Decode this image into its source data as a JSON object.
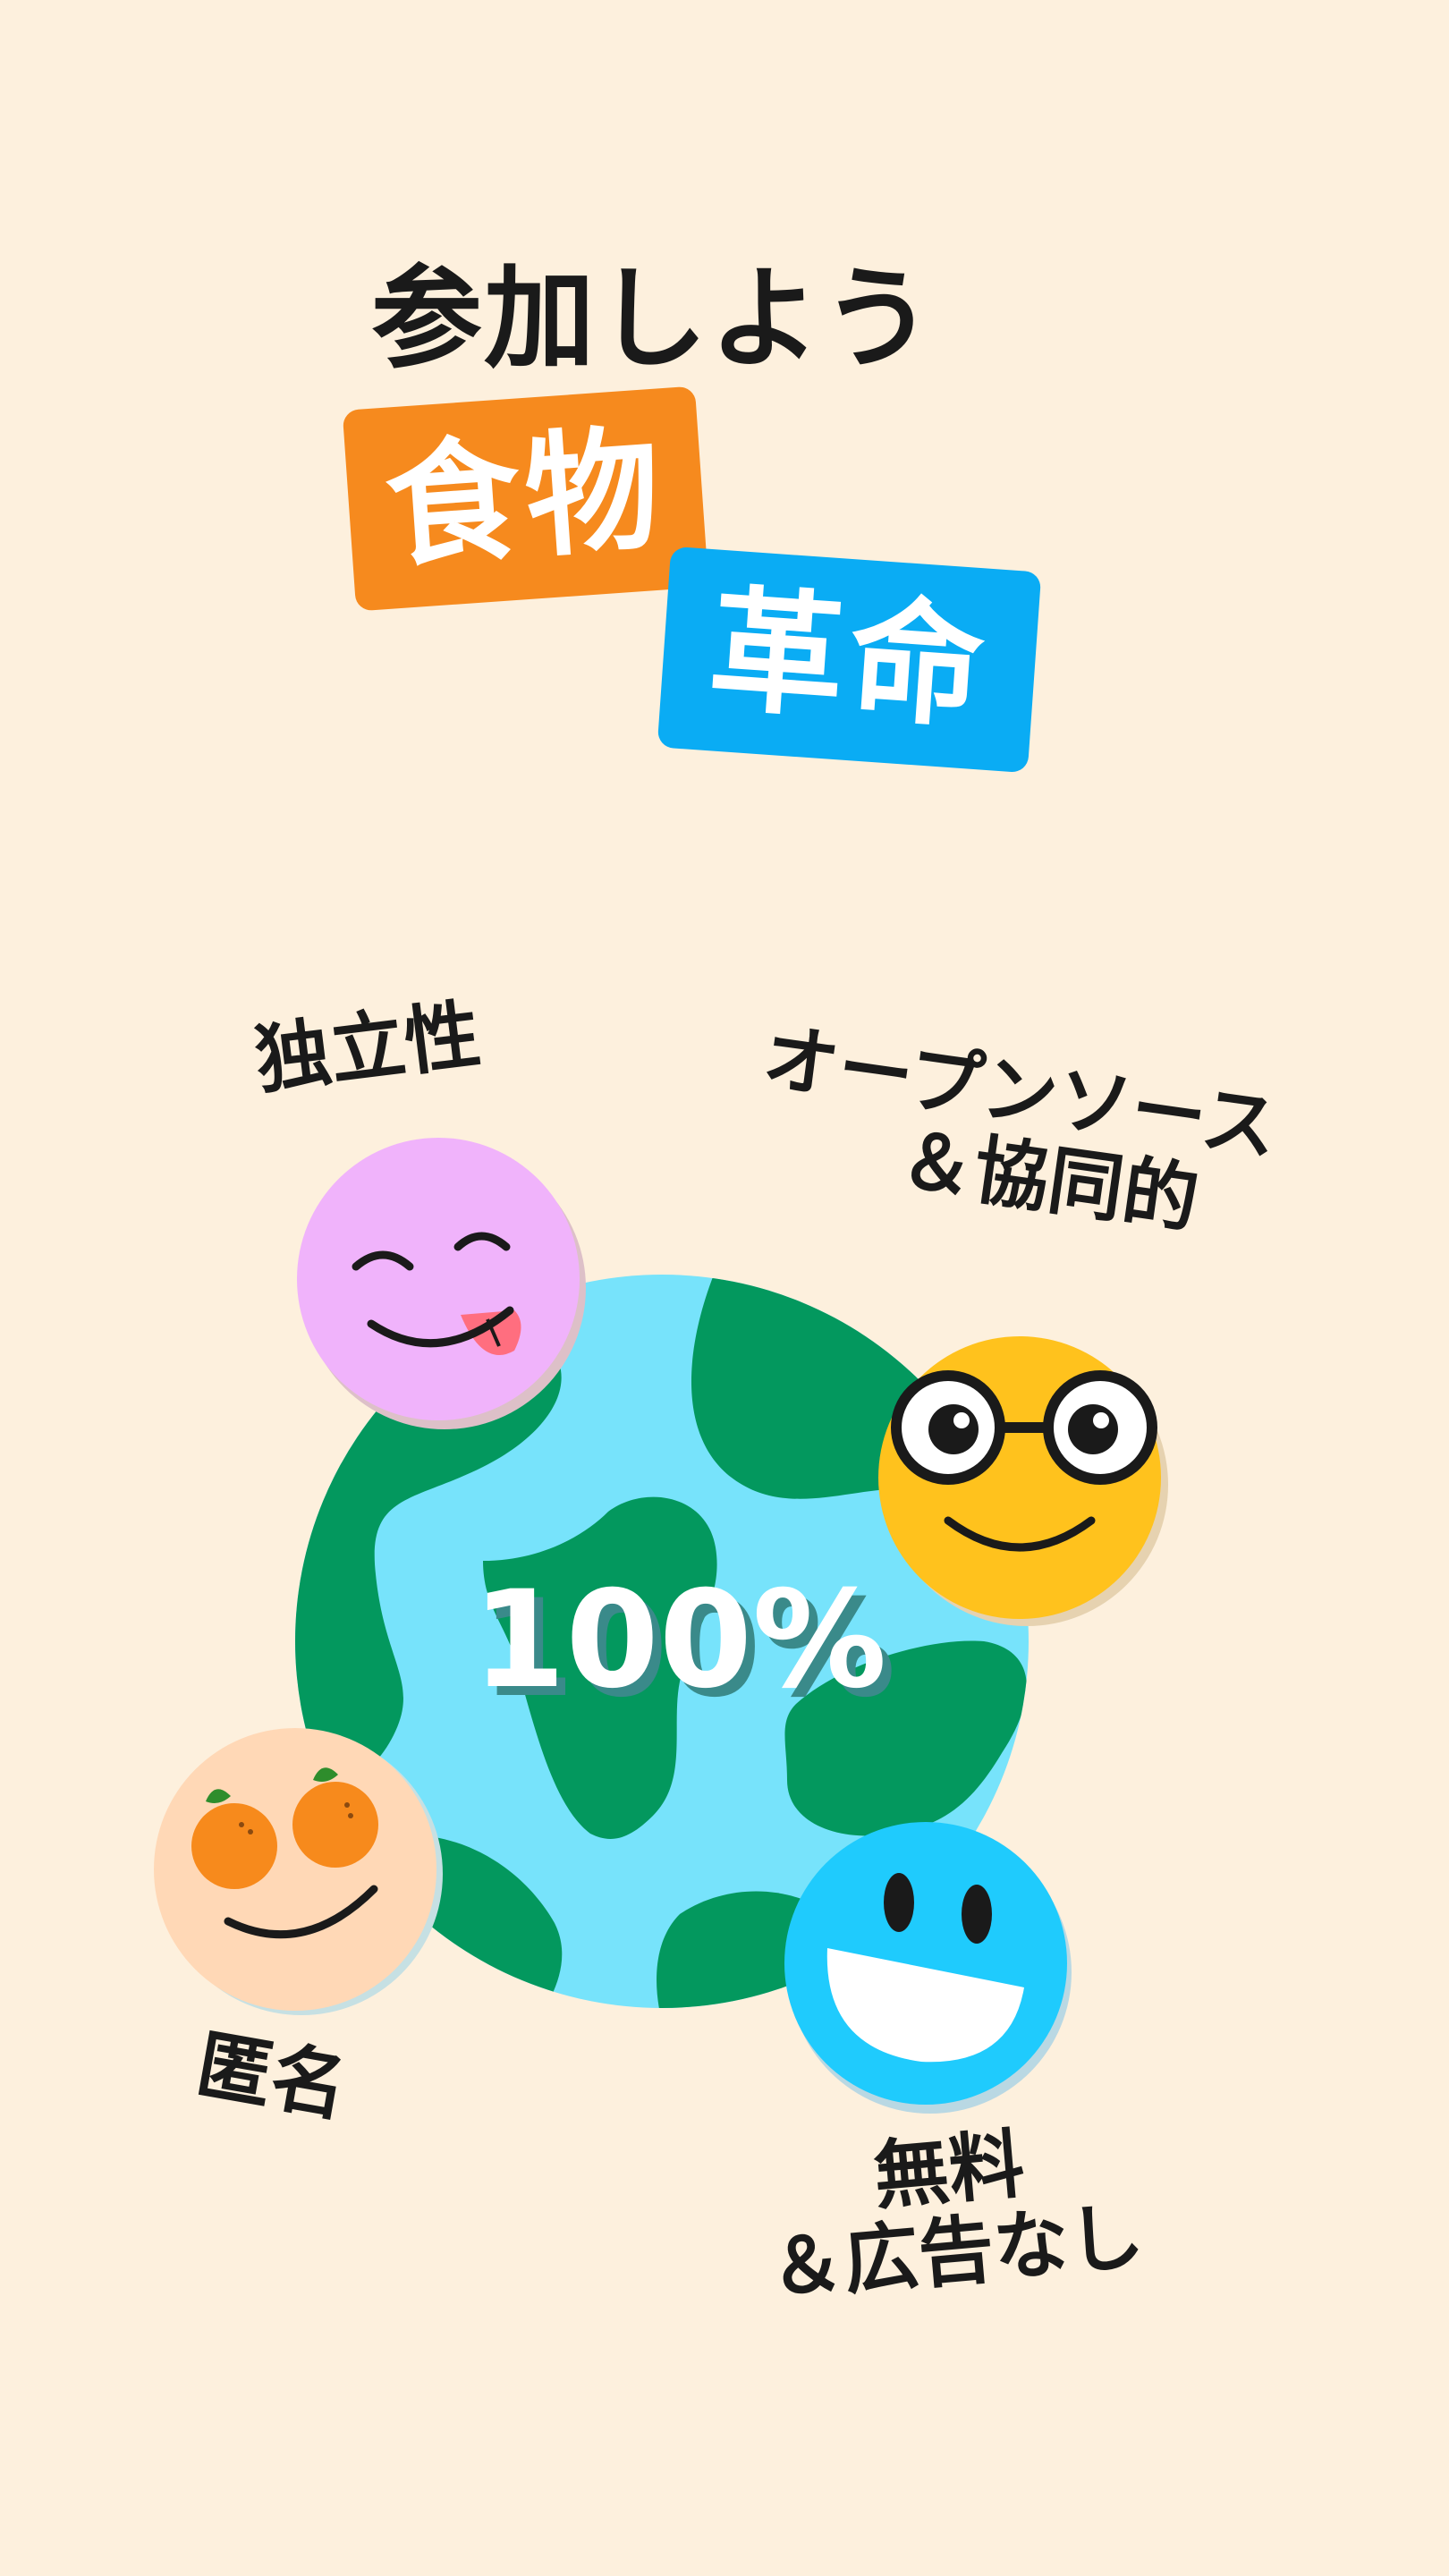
{
  "headline": "参加しよう",
  "tags": [
    {
      "label": "食物",
      "color": "#f68a1e"
    },
    {
      "label": "革命",
      "color": "#0aacf4"
    }
  ],
  "features": {
    "independence": "独立性",
    "open_source_line1": "オープンソース",
    "open_source_line2": "＆協同的",
    "anonymous": "匿名",
    "free_line1": "無料",
    "free_line2": "＆広告なし"
  },
  "globe": {
    "percent": "100%",
    "ocean_color": "#77e3fb",
    "land_color": "#03985e"
  },
  "faces": [
    {
      "name": "playful",
      "color": "#f0b3fb"
    },
    {
      "name": "nerd",
      "color": "#ffc21d"
    },
    {
      "name": "orange-eyes",
      "color": "#ffd8b6"
    },
    {
      "name": "laughing",
      "color": "#1fcbfd"
    }
  ]
}
